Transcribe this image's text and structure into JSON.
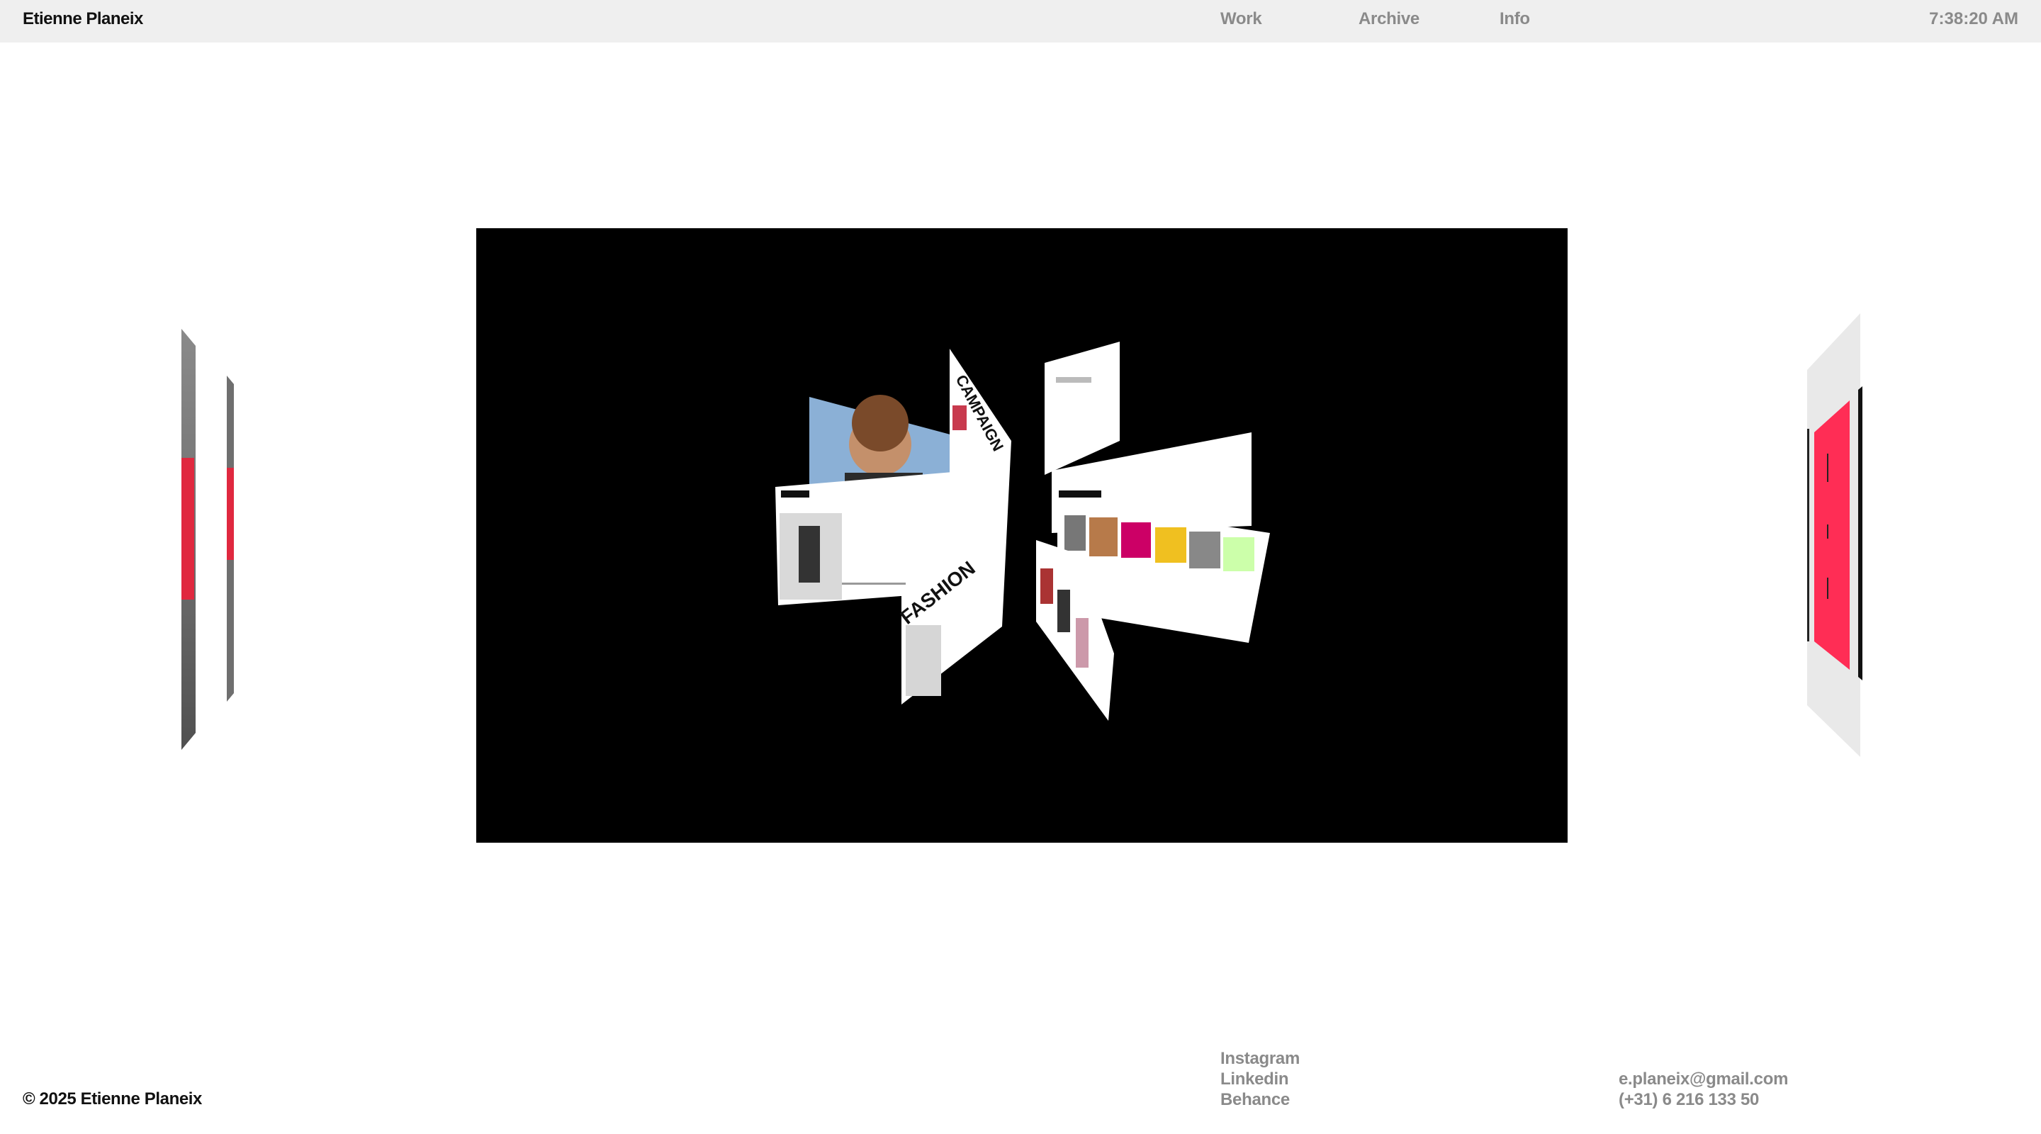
{
  "header": {
    "brand": "Etienne Planeix",
    "nav": [
      "Work",
      "Archive",
      "Info"
    ],
    "time": "7:38:20 AM"
  },
  "showcase": {
    "card_labels": [
      "FASHION",
      "CAMPAIGN"
    ]
  },
  "footer": {
    "copyright": "© 2025 Etienne Planeix",
    "social": [
      "Instagram",
      "Linkedin",
      "Behance"
    ],
    "email": "e.planeix@gmail.com",
    "phone": "(+31) 6 216 133 50"
  },
  "colors": {
    "topbar": "#efefef",
    "stage": "#000000",
    "accent_red": "#ff2d55",
    "muted_text": "#8a8a8a"
  }
}
